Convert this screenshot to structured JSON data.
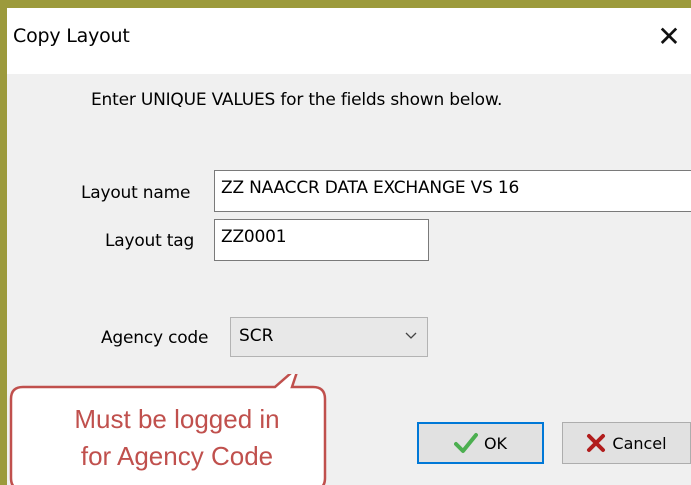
{
  "dialog": {
    "title": "Copy Layout",
    "close_glyph": "✕",
    "instruction": "Enter UNIQUE VALUES for the fields shown below.",
    "layout_name": {
      "label": "Layout name",
      "value": "ZZ NAACCR DATA EXCHANGE VS 16"
    },
    "layout_tag": {
      "label": "Layout tag",
      "value": "ZZ0001"
    },
    "agency_code": {
      "label": "Agency code",
      "value": "SCR"
    },
    "ok_button": {
      "label": "OK",
      "icon": "checkmark-icon"
    },
    "cancel_button": {
      "label": "Cancel",
      "icon": "x-icon"
    }
  },
  "annotation": {
    "line1": "Must be logged in",
    "line2": "for Agency Code",
    "color": "#c0504d"
  },
  "colors": {
    "background": "#9c9a3c",
    "focus_border": "#0078d7",
    "check_green": "#4caf50",
    "cancel_red": "#b11d1d"
  }
}
